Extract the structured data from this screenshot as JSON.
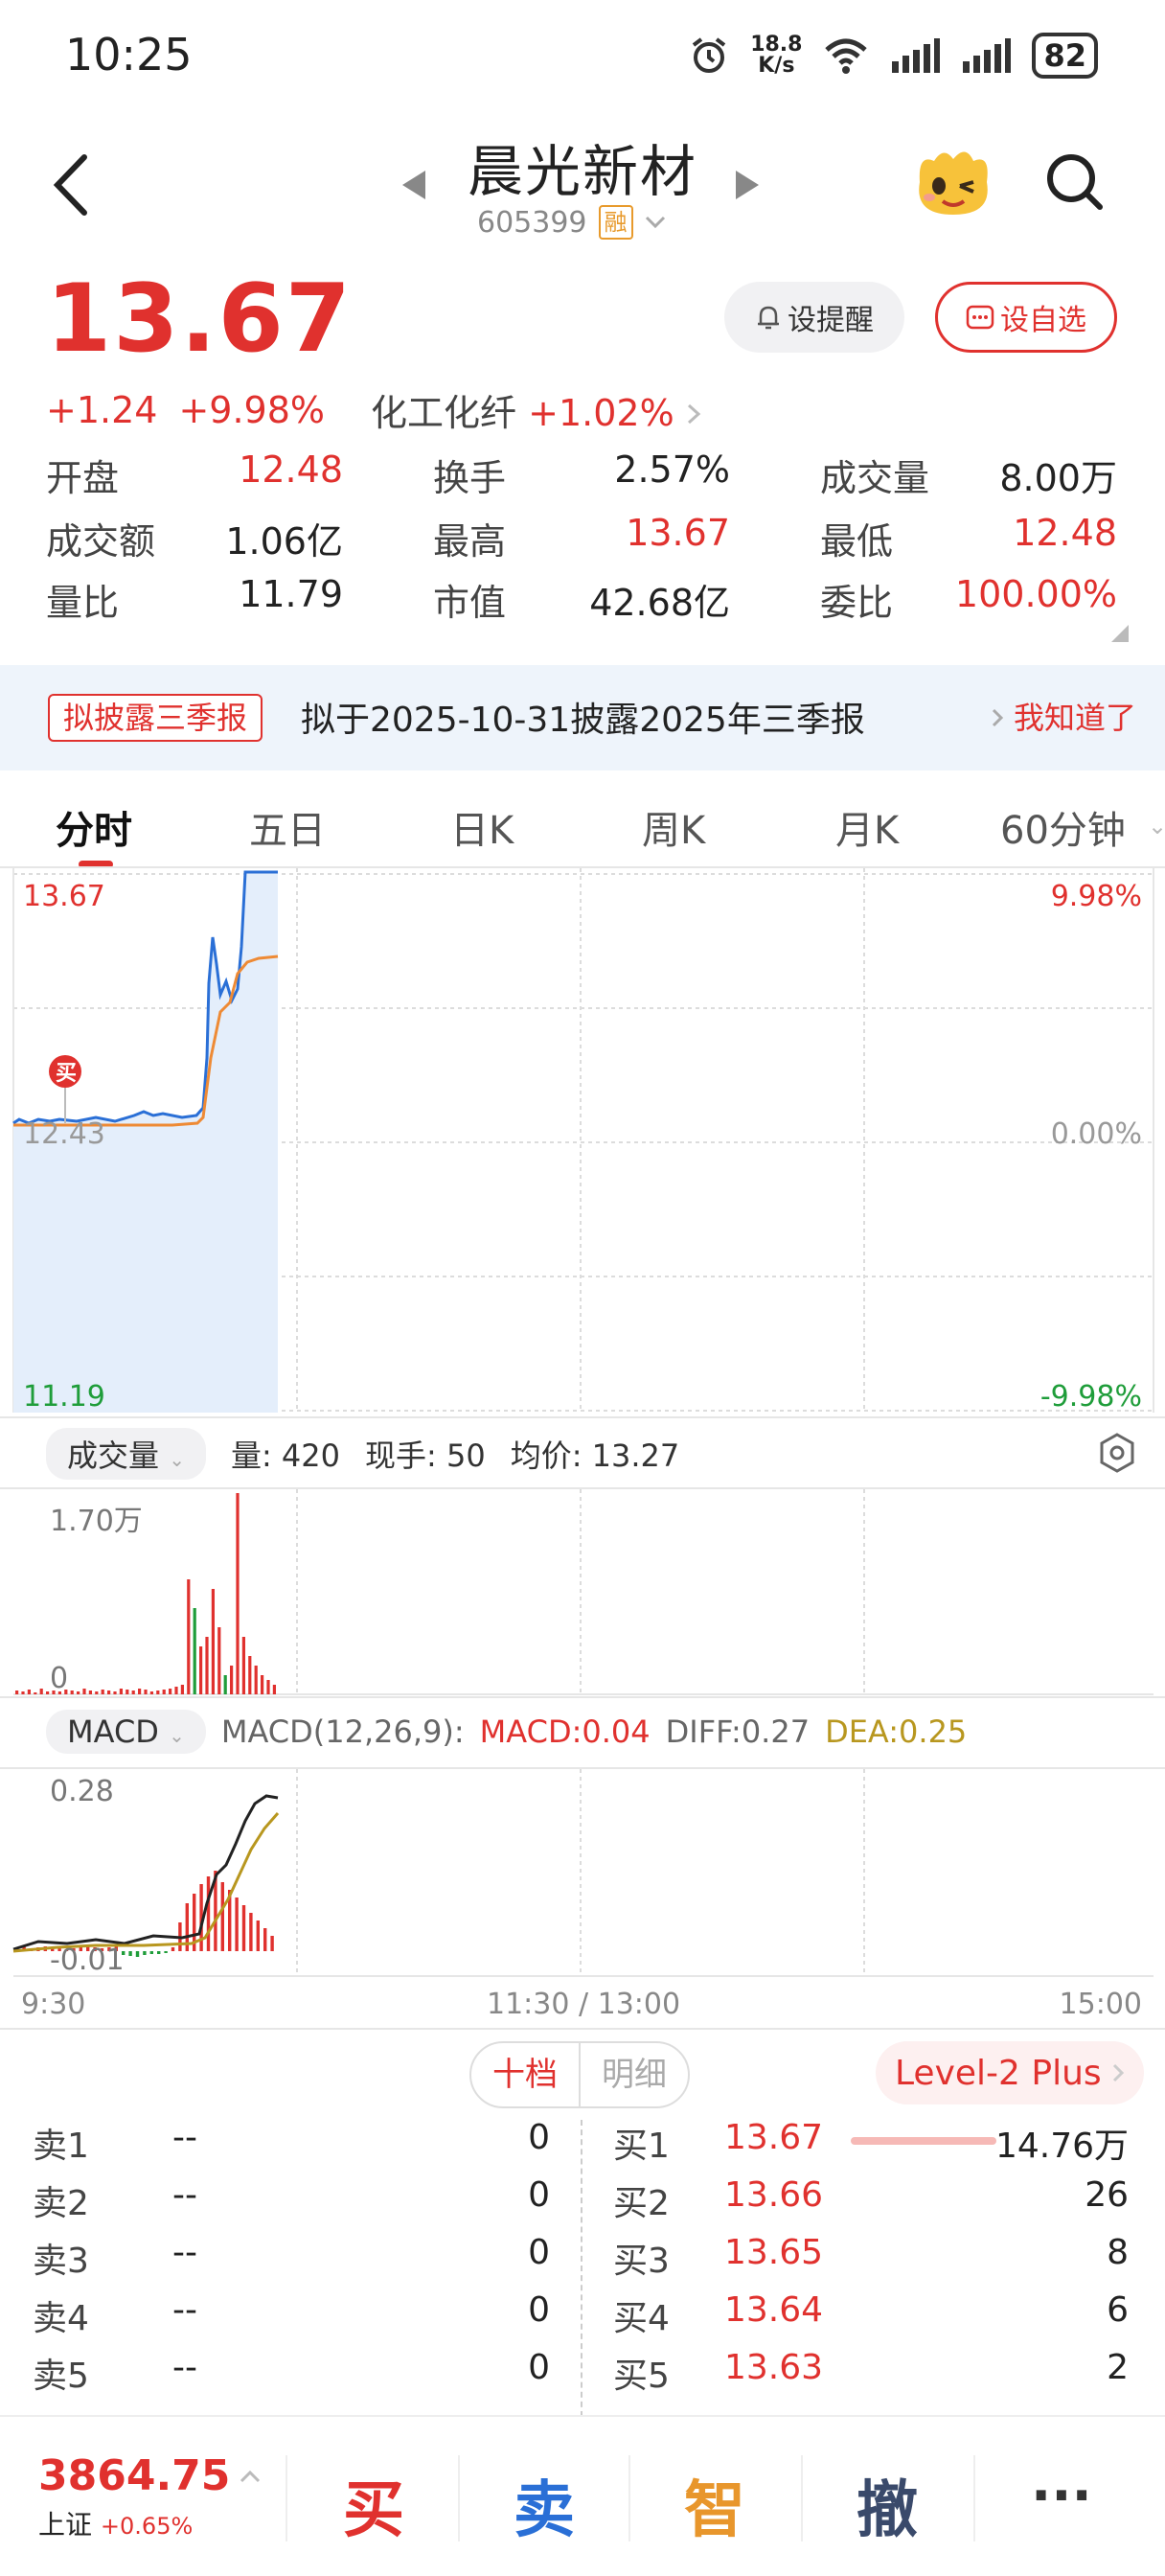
{
  "status_bar": {
    "time": "10:25",
    "net_speed_value": "18.8",
    "net_speed_unit": "K/s",
    "battery": "82",
    "icons": [
      "alarm-icon",
      "wifi-icon",
      "signal-icon",
      "signal-icon",
      "battery-icon"
    ]
  },
  "header": {
    "stock_name": "晨光新材",
    "stock_code": "605399",
    "margin_badge": "融"
  },
  "quote": {
    "price": "13.67",
    "change": "+1.24",
    "change_pct": "+9.98%",
    "sector_name": "化工化纤",
    "sector_change": "+1.02%",
    "alert_label": "设提醒",
    "favorite_label": "设自选"
  },
  "stats": [
    {
      "label": "开盘",
      "value": "12.48",
      "color": "red"
    },
    {
      "label": "换手",
      "value": "2.57%",
      "color": "black"
    },
    {
      "label": "成交量",
      "value": "8.00万",
      "color": "black"
    },
    {
      "label": "成交额",
      "value": "1.06亿",
      "color": "black"
    },
    {
      "label": "最高",
      "value": "13.67",
      "color": "red"
    },
    {
      "label": "最低",
      "value": "12.48",
      "color": "red"
    },
    {
      "label": "量比",
      "value": "11.79",
      "color": "black"
    },
    {
      "label": "市值",
      "value": "42.68亿",
      "color": "black"
    },
    {
      "label": "委比",
      "value": "100.00%",
      "color": "red"
    }
  ],
  "notice": {
    "tag": "拟披露三季报",
    "text": "拟于2025-10-31披露2025年三季报",
    "action": "我知道了"
  },
  "tabs": [
    "分时",
    "五日",
    "日K",
    "周K",
    "月K",
    "60分钟"
  ],
  "intraday": {
    "price_top": "13.67",
    "price_mid": "12.43",
    "price_bottom": "11.19",
    "pct_top": "9.98%",
    "pct_mid": "0.00%",
    "pct_bottom": "-9.98%",
    "buy_marker": "买"
  },
  "volume_panel": {
    "selector": "成交量",
    "volume_label": "量: 420",
    "current_label": "现手: 50",
    "avg_label": "均价: 13.27",
    "max_label": "1.70万",
    "zero_label": "0"
  },
  "macd_panel": {
    "selector": "MACD",
    "params": "MACD(12,26,9):",
    "macd": "MACD:0.04",
    "diff": "DIFF:0.27",
    "dea": "DEA:0.25",
    "top_label": "0.28",
    "bottom_label": "-0.01"
  },
  "time_axis": {
    "start": "9:30",
    "mid": "11:30 / 13:00",
    "end": "15:00"
  },
  "order_book": {
    "tab_active": "十档",
    "tab_inactive": "明细",
    "level2": "Level-2 Plus",
    "asks": [
      {
        "label": "卖1",
        "price": "--",
        "volume": "0"
      },
      {
        "label": "卖2",
        "price": "--",
        "volume": "0"
      },
      {
        "label": "卖3",
        "price": "--",
        "volume": "0"
      },
      {
        "label": "卖4",
        "price": "--",
        "volume": "0"
      },
      {
        "label": "卖5",
        "price": "--",
        "volume": "0"
      }
    ],
    "bids": [
      {
        "label": "买1",
        "price": "13.67",
        "volume": "14.76万"
      },
      {
        "label": "买2",
        "price": "13.66",
        "volume": "26"
      },
      {
        "label": "买3",
        "price": "13.65",
        "volume": "8"
      },
      {
        "label": "买4",
        "price": "13.64",
        "volume": "6"
      },
      {
        "label": "买5",
        "price": "13.63",
        "volume": "2"
      }
    ]
  },
  "bottom_bar": {
    "index_value": "3864.75",
    "index_name": "上证",
    "index_change": "+0.65%",
    "buy": "买",
    "sell": "卖",
    "smart": "智",
    "cancel": "撤",
    "more": "···"
  },
  "colors": {
    "up": "#e0312e",
    "down": "#1f9d3a",
    "price_line": "#2a6fd6",
    "avg_line": "#ee8a35",
    "dea_line": "#b8971f",
    "smart_orange": "#e8962c",
    "cancel_blue": "#3a4a6b"
  }
}
